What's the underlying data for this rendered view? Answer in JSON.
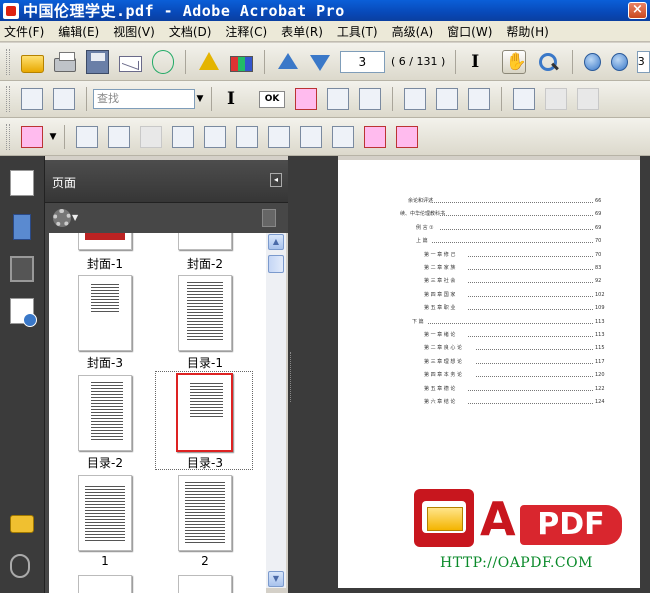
{
  "window": {
    "title": "中国伦理学史.pdf - Adobe Acrobat Pro",
    "close_label": "×"
  },
  "menu": [
    "文件(F)",
    "编辑(E)",
    "视图(V)",
    "文档(D)",
    "注释(C)",
    "表单(R)",
    "工具(T)",
    "高级(A)",
    "窗口(W)",
    "帮助(H)"
  ],
  "toolbar": {
    "page_number": "3",
    "page_count": "( 6 / 131 )",
    "zoom_value": "3",
    "find_placeholder": "查找",
    "ok_label": "OK"
  },
  "panel": {
    "title": "页面",
    "collapse_label": "◂"
  },
  "thumbnails": [
    {
      "label": "封面-1"
    },
    {
      "label": "封面-2"
    },
    {
      "label": "封面-3"
    },
    {
      "label": "目录-1"
    },
    {
      "label": "目录-2"
    },
    {
      "label": "目录-3",
      "selected": true
    },
    {
      "label": "1"
    },
    {
      "label": "2"
    }
  ],
  "toc": [
    {
      "text": "余论和评述",
      "page": "66",
      "indent": 0
    },
    {
      "text": "续、中华伦理教科书",
      "page": "69",
      "indent": -1
    },
    {
      "text": "例 言 ①",
      "page": "69",
      "indent": 1
    },
    {
      "text": "上 篇",
      "page": "70",
      "indent": 1
    },
    {
      "text": "第 一 章  修 己",
      "page": "70",
      "indent": 2
    },
    {
      "text": "第 二 章  家 族",
      "page": "83",
      "indent": 2
    },
    {
      "text": "第 三 章  社 会",
      "page": "92",
      "indent": 2
    },
    {
      "text": "第 四 章  国 家",
      "page": "102",
      "indent": 2
    },
    {
      "text": "第 五 章  职 业",
      "page": "109",
      "indent": 2
    },
    {
      "text": "下 篇",
      "page": "113",
      "indent": 0.5
    },
    {
      "text": "第 一 章  绪 论",
      "page": "113",
      "indent": 2
    },
    {
      "text": "第 二 章  良 心 论",
      "page": "115",
      "indent": 2
    },
    {
      "text": "第 三 章  理 想 论",
      "page": "117",
      "indent": 2
    },
    {
      "text": "第 四 章  本 务 论",
      "page": "120",
      "indent": 2
    },
    {
      "text": "第 五 章  德 论",
      "page": "122",
      "indent": 2
    },
    {
      "text": "第 六 章  结 论",
      "page": "124",
      "indent": 2
    }
  ],
  "logo": {
    "letter": "A",
    "pdf": "PDF",
    "url": "HTTP://OAPDF.COM"
  }
}
